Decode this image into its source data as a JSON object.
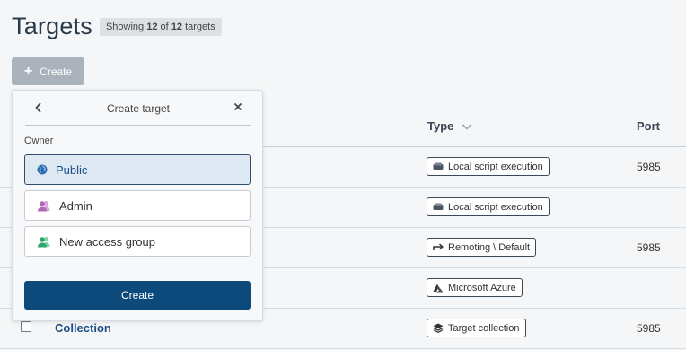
{
  "page": {
    "title": "Targets",
    "count_prefix": "Showing",
    "count_shown": "12",
    "count_of": "of",
    "count_total": "12",
    "count_suffix": "targets"
  },
  "toolbar": {
    "create_label": "Create"
  },
  "table": {
    "columns": {
      "type": "Type",
      "port": "Port"
    },
    "rows": [
      {
        "type": "Local script execution",
        "type_icon": "drive-icon",
        "port": "5985"
      },
      {
        "type": "Local script execution",
        "type_icon": "drive-icon",
        "port": ""
      },
      {
        "type": "Remoting \\ Default",
        "type_icon": "arrow-right-icon",
        "port": "5985"
      },
      {
        "type": "Microsoft Azure",
        "type_icon": "azure-icon",
        "port": ""
      },
      {
        "name": "Collection",
        "type": "Target collection",
        "type_icon": "layers-icon",
        "port": "5985"
      }
    ]
  },
  "create_panel": {
    "title": "Create target",
    "owner_label": "Owner",
    "options": [
      {
        "label": "Public",
        "icon": "globe-icon",
        "selected": true
      },
      {
        "label": "Admin",
        "icon": "users-icon",
        "icon_color": "#b06ab8",
        "selected": false
      },
      {
        "label": "New access group",
        "icon": "users-icon",
        "icon_color": "#2aa86b",
        "selected": false
      }
    ],
    "submit_label": "Create"
  },
  "colors": {
    "accent": "#0d4a7c",
    "link": "#1b4e86",
    "selected_bg": "#dfe9f3"
  }
}
